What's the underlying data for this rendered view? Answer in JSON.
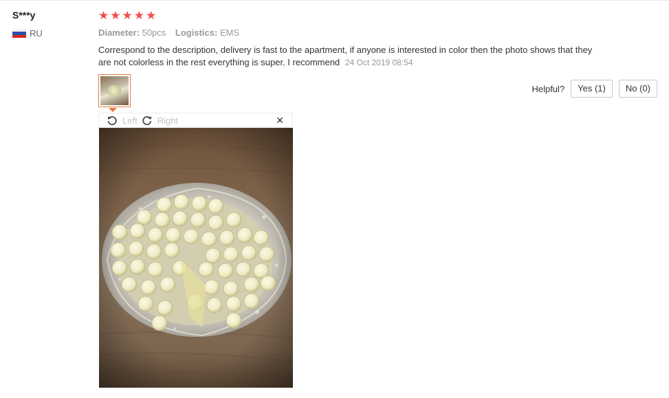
{
  "review": {
    "user_name": "S***y",
    "country_code": "RU",
    "rating": 5,
    "stars": [
      "★",
      "★",
      "★",
      "★",
      "★"
    ],
    "attr_diameter_label": "Diameter:",
    "attr_diameter_value": "50pcs",
    "attr_logistics_label": "Logistics:",
    "attr_logistics_value": "EMS",
    "text": "Correspond to the description, delivery is fast to the apartment, if anyone is interested in color then the photo shows that they are not colorless in the rest everything is super. I recommend",
    "date": "24 Oct 2019 08:54"
  },
  "helpful": {
    "label": "Helpful?",
    "yes_label": "Yes (1)",
    "no_label": "No (0)"
  },
  "viewer": {
    "rotate_left_label": "Left",
    "rotate_right_label": "Right",
    "close_glyph": "✕"
  },
  "colors": {
    "star": "#f44c4c",
    "thumb_border": "#e67a3c",
    "muted_text": "#999999"
  },
  "icons": {
    "rotate_left": "rotate-left-icon",
    "rotate_right": "rotate-right-icon",
    "close": "close-icon",
    "flag": "russia-flag-icon"
  }
}
